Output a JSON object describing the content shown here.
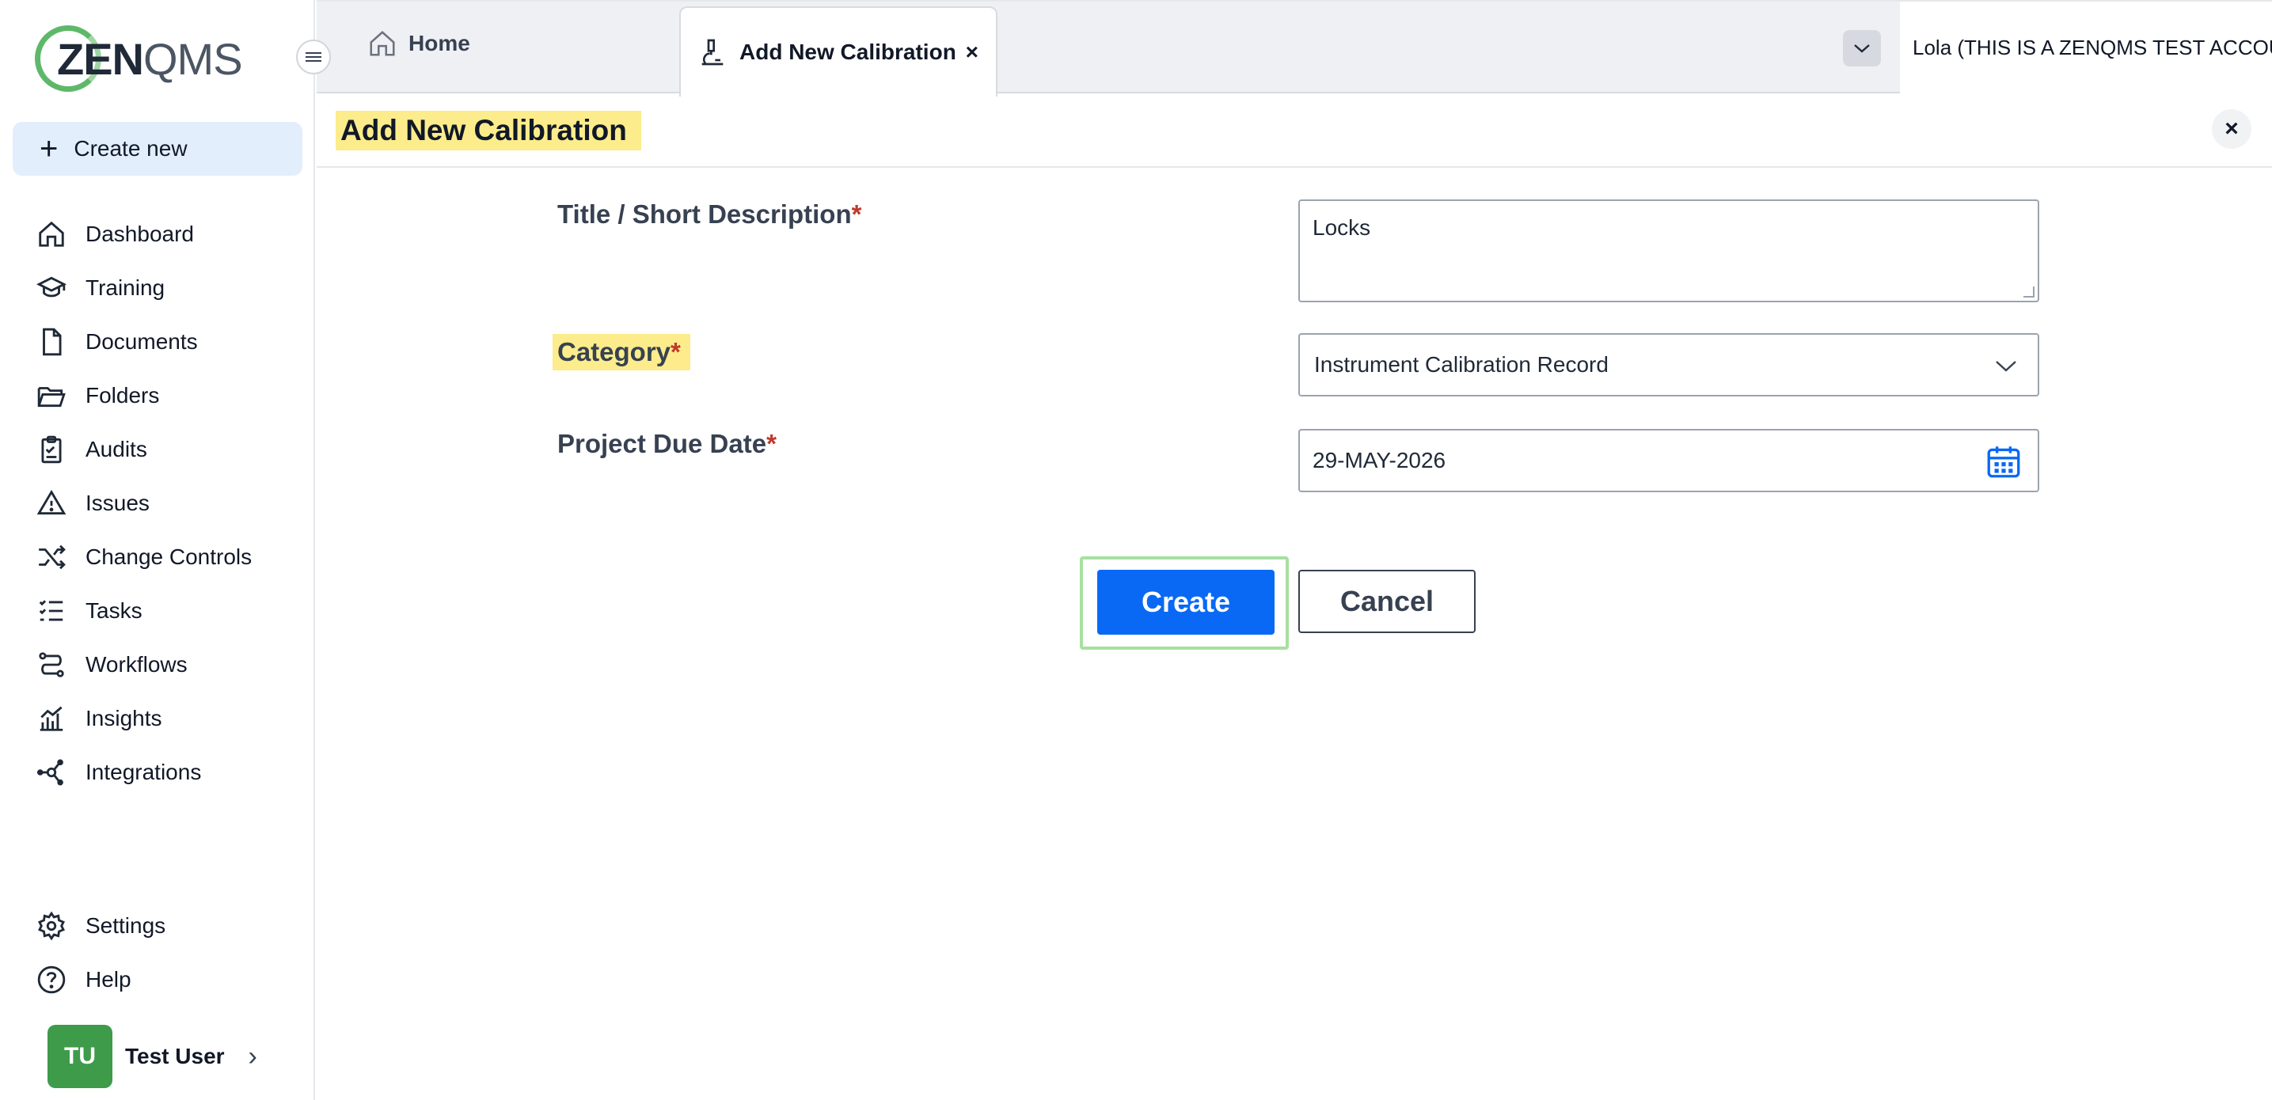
{
  "sidebar": {
    "logo": "ZENQMS",
    "create_new_label": "Create new",
    "items": [
      {
        "label": "Dashboard",
        "icon": "home-icon"
      },
      {
        "label": "Training",
        "icon": "graduation-cap-icon"
      },
      {
        "label": "Documents",
        "icon": "document-icon"
      },
      {
        "label": "Folders",
        "icon": "folder-open-icon"
      },
      {
        "label": "Audits",
        "icon": "clipboard-check-icon"
      },
      {
        "label": "Issues",
        "icon": "warning-triangle-icon"
      },
      {
        "label": "Change Controls",
        "icon": "shuffle-icon"
      },
      {
        "label": "Tasks",
        "icon": "checklist-icon"
      },
      {
        "label": "Workflows",
        "icon": "workflow-icon"
      },
      {
        "label": "Insights",
        "icon": "chart-icon"
      },
      {
        "label": "Integrations",
        "icon": "network-icon"
      }
    ],
    "bottom_items": [
      {
        "label": "Settings",
        "icon": "gear-icon"
      },
      {
        "label": "Help",
        "icon": "help-circle-icon"
      }
    ],
    "user": {
      "initials": "TU",
      "name": "Test User"
    }
  },
  "tabs": {
    "home_label": "Home",
    "active_label": "Add New Calibration",
    "close_symbol": "×",
    "account_label": "Lola (THIS IS A ZENQMS TEST ACCOUNT)"
  },
  "page": {
    "title": "Add New Calibration",
    "close_symbol": "×"
  },
  "form": {
    "title_label": "Title / Short Description",
    "title_value": "Locks",
    "category_label": "Category",
    "category_value": "Instrument Calibration Record",
    "due_date_label": "Project Due Date",
    "due_date_value": "29-MAY-2026",
    "required_marker": "*",
    "create_label": "Create",
    "cancel_label": "Cancel"
  },
  "colors": {
    "primary": "#0969f5",
    "highlight": "#fcec8b",
    "brand_green": "#5fb86a",
    "avatar": "#3e9b4a"
  }
}
